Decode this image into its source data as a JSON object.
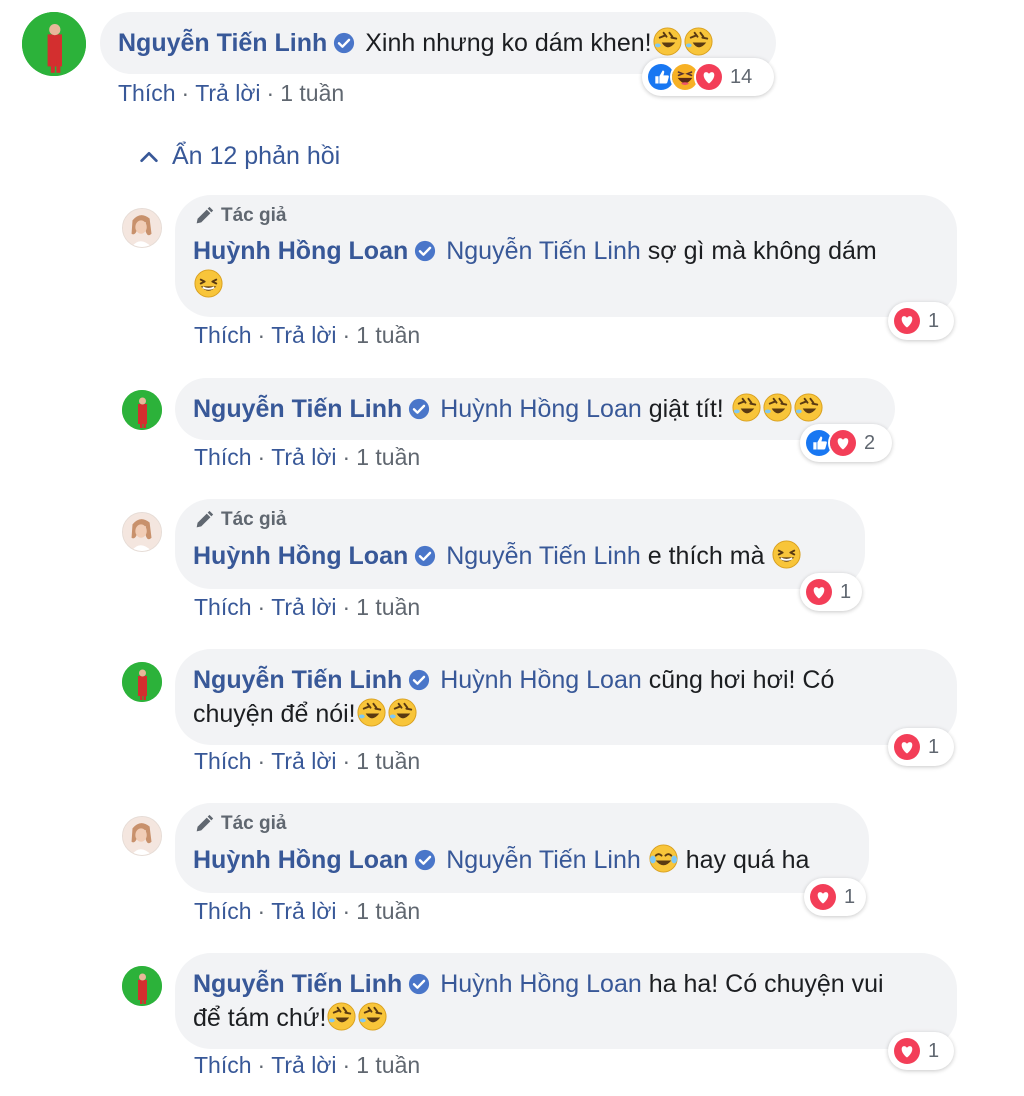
{
  "top_comment": {
    "author": "Nguyễn Tiến Linh",
    "text": "Xinh nhưng ko dám khen!",
    "meta": {
      "like": "Thích",
      "reply": "Trả lời",
      "time": "1 tuần",
      "sep": "·"
    },
    "reactions": {
      "icons": [
        "like-reaction-icon",
        "haha-reaction-icon",
        "love-reaction-icon"
      ],
      "count": "14"
    }
  },
  "replies_toggle": {
    "label": "Ẩn 12 phản hồi",
    "icon": "chevron-up-icon"
  },
  "author_tag": "Tác giả",
  "replies": [
    {
      "author": "Huỳnh Hồng Loan",
      "mention": "Nguyễn Tiến Linh",
      "text": "sợ gì mà không dám",
      "author_tag": true,
      "reaction_count": "1",
      "time": "1 tuần"
    },
    {
      "author": "Nguyễn Tiến Linh",
      "mention": "Huỳnh Hồng Loan",
      "text": "giật tít!",
      "author_tag": false,
      "reaction_count": "2",
      "time": "1 tuần"
    },
    {
      "author": "Huỳnh Hồng Loan",
      "mention": "Nguyễn Tiến Linh",
      "text": "e thích mà",
      "author_tag": true,
      "reaction_count": "1",
      "time": "1 tuần"
    },
    {
      "author": "Nguyễn Tiến Linh",
      "mention": "Huỳnh Hồng Loan",
      "text_line1": "cũng hơi hơi! Có",
      "text_line2": "chuyện để nói!",
      "author_tag": false,
      "reaction_count": "1",
      "time": "1 tuần"
    },
    {
      "author": "Huỳnh Hồng Loan",
      "mention": "Nguyễn Tiến Linh",
      "text": "hay quá ha",
      "author_tag": true,
      "reaction_count": "1",
      "time": "1 tuần"
    },
    {
      "author": "Nguyễn Tiến Linh",
      "mention": "Huỳnh Hồng Loan",
      "text_line1": "ha ha! Có chuyện vui",
      "text_line2": "để tám chứ!",
      "author_tag": false,
      "reaction_count": "1",
      "time": "1 tuần"
    }
  ],
  "meta_labels": {
    "like": "Thích",
    "reply": "Trả lời",
    "sep": "·"
  },
  "colors": {
    "link": "#385898",
    "bubble": "#f2f3f5",
    "meta": "#606770",
    "like_blue": "#1877f2",
    "love_red": "#f33e58",
    "haha_yellow": "#f7b125",
    "avatar_green": "#2cb23a"
  }
}
